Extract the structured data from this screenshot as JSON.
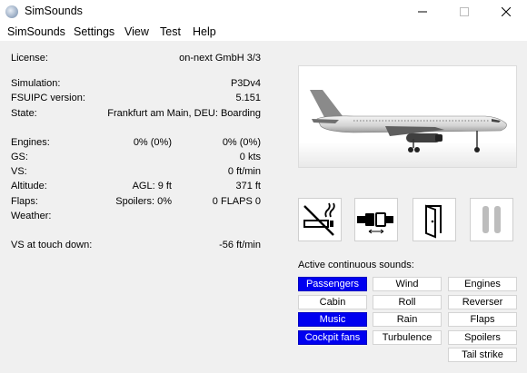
{
  "window": {
    "title": "SimSounds"
  },
  "menu": [
    "SimSounds",
    "Settings",
    "View",
    "Test",
    "Help"
  ],
  "info": {
    "license_label": "License:",
    "license_value": "on-next GmbH 3/3",
    "simulation_label": "Simulation:",
    "simulation_value": "P3Dv4",
    "fsuipc_label": "FSUIPC version:",
    "fsuipc_value": "5.151",
    "state_label": "State:",
    "state_value": "Frankfurt am Main, DEU:  Boarding",
    "engines_label": "Engines:",
    "engines_value1": "0% (0%)",
    "engines_value2": "0% (0%)",
    "gs_label": "GS:",
    "gs_value": "0 kts",
    "vs_label": "VS:",
    "vs_value": "0 ft/min",
    "altitude_label": "Altitude:",
    "altitude_value1": "AGL: 9 ft",
    "altitude_value2": "371 ft",
    "flaps_label": "Flaps:",
    "flaps_value1": "Spoilers: 0%",
    "flaps_value2": "0 FLAPS 0",
    "weather_label": "Weather:",
    "touchdown_label": "VS at touch down:",
    "touchdown_value": "-56 ft/min"
  },
  "status_icons": [
    "no-smoking-icon",
    "seatbelt-icon",
    "door-icon",
    "pause-icon"
  ],
  "sounds": {
    "label": "Active continuous sounds:",
    "col1": [
      {
        "label": "Passengers",
        "on": true
      },
      {
        "label": "Cabin",
        "on": false
      },
      {
        "label": "Music",
        "on": true
      },
      {
        "label": "Cockpit fans",
        "on": true
      }
    ],
    "col2": [
      {
        "label": "Wind",
        "on": false
      },
      {
        "label": "Roll",
        "on": false
      },
      {
        "label": "Rain",
        "on": false
      },
      {
        "label": "Turbulence",
        "on": false
      }
    ],
    "col3": [
      {
        "label": "Engines",
        "on": false
      },
      {
        "label": "Reverser",
        "on": false
      },
      {
        "label": "Flaps",
        "on": false
      },
      {
        "label": "Spoilers",
        "on": false
      },
      {
        "label": "Tail strike",
        "on": false
      }
    ]
  },
  "colors": {
    "active": "#0000f0",
    "window_bg": "#f0f0f0"
  }
}
